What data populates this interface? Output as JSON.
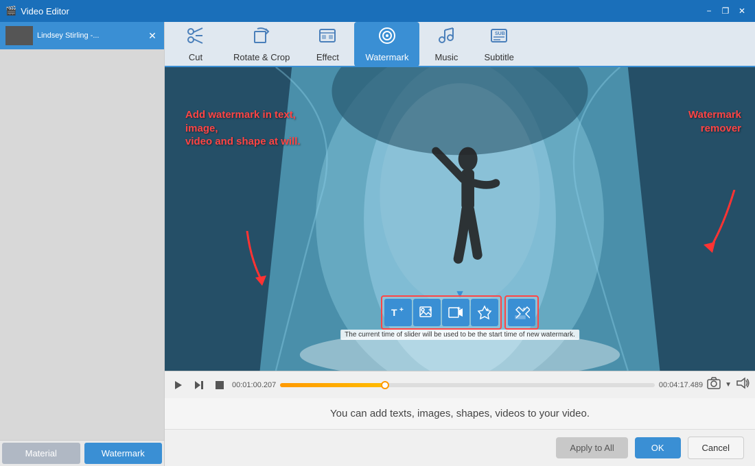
{
  "titleBar": {
    "title": "Video Editor",
    "controls": {
      "minimize": "−",
      "restore": "❐",
      "close": "✕"
    }
  },
  "sidebar": {
    "file": {
      "name": "Lindsey Stirling -...",
      "close": "✕"
    },
    "tabs": [
      {
        "id": "material",
        "label": "Material",
        "active": false
      },
      {
        "id": "watermark",
        "label": "Watermark",
        "active": true
      }
    ]
  },
  "nav": {
    "items": [
      {
        "id": "cut",
        "label": "Cut",
        "icon": "✂"
      },
      {
        "id": "rotate-crop",
        "label": "Rotate & Crop",
        "icon": "↻"
      },
      {
        "id": "effect",
        "label": "Effect",
        "icon": "🎬"
      },
      {
        "id": "watermark",
        "label": "Watermark",
        "icon": "💿",
        "active": true
      },
      {
        "id": "music",
        "label": "Music",
        "icon": "♪"
      },
      {
        "id": "subtitle",
        "label": "Subtitle",
        "icon": "⊡"
      }
    ]
  },
  "video": {
    "annotations": {
      "left": {
        "text": "Add watermark in text, image,\nvideo and shape at will.",
        "arrow": "↓"
      },
      "right": {
        "text": "Watermark\nremover",
        "arrow": "↙"
      }
    },
    "toolbar": {
      "buttons": [
        {
          "id": "add-text",
          "icon": "T+",
          "label": "Add Text Watermark"
        },
        {
          "id": "add-image",
          "icon": "🖼+",
          "label": "Add Image Watermark"
        },
        {
          "id": "add-video",
          "icon": "▶+",
          "label": "Add Video Watermark"
        },
        {
          "id": "add-shape",
          "icon": "✦+",
          "label": "Add Shape Watermark"
        }
      ],
      "remover": {
        "id": "remover",
        "icon": "✏+",
        "label": "Watermark Remover"
      }
    },
    "timeline": {
      "current": "00:01:00.207",
      "total": "00:04:17.489",
      "progress": 28,
      "info": "The current time of slider will be used to be the start time of new watermark."
    }
  },
  "instructions": {
    "text": "You can add texts, images, shapes, videos to your video."
  },
  "actions": {
    "applyAll": "Apply to All",
    "ok": "OK",
    "cancel": "Cancel"
  }
}
